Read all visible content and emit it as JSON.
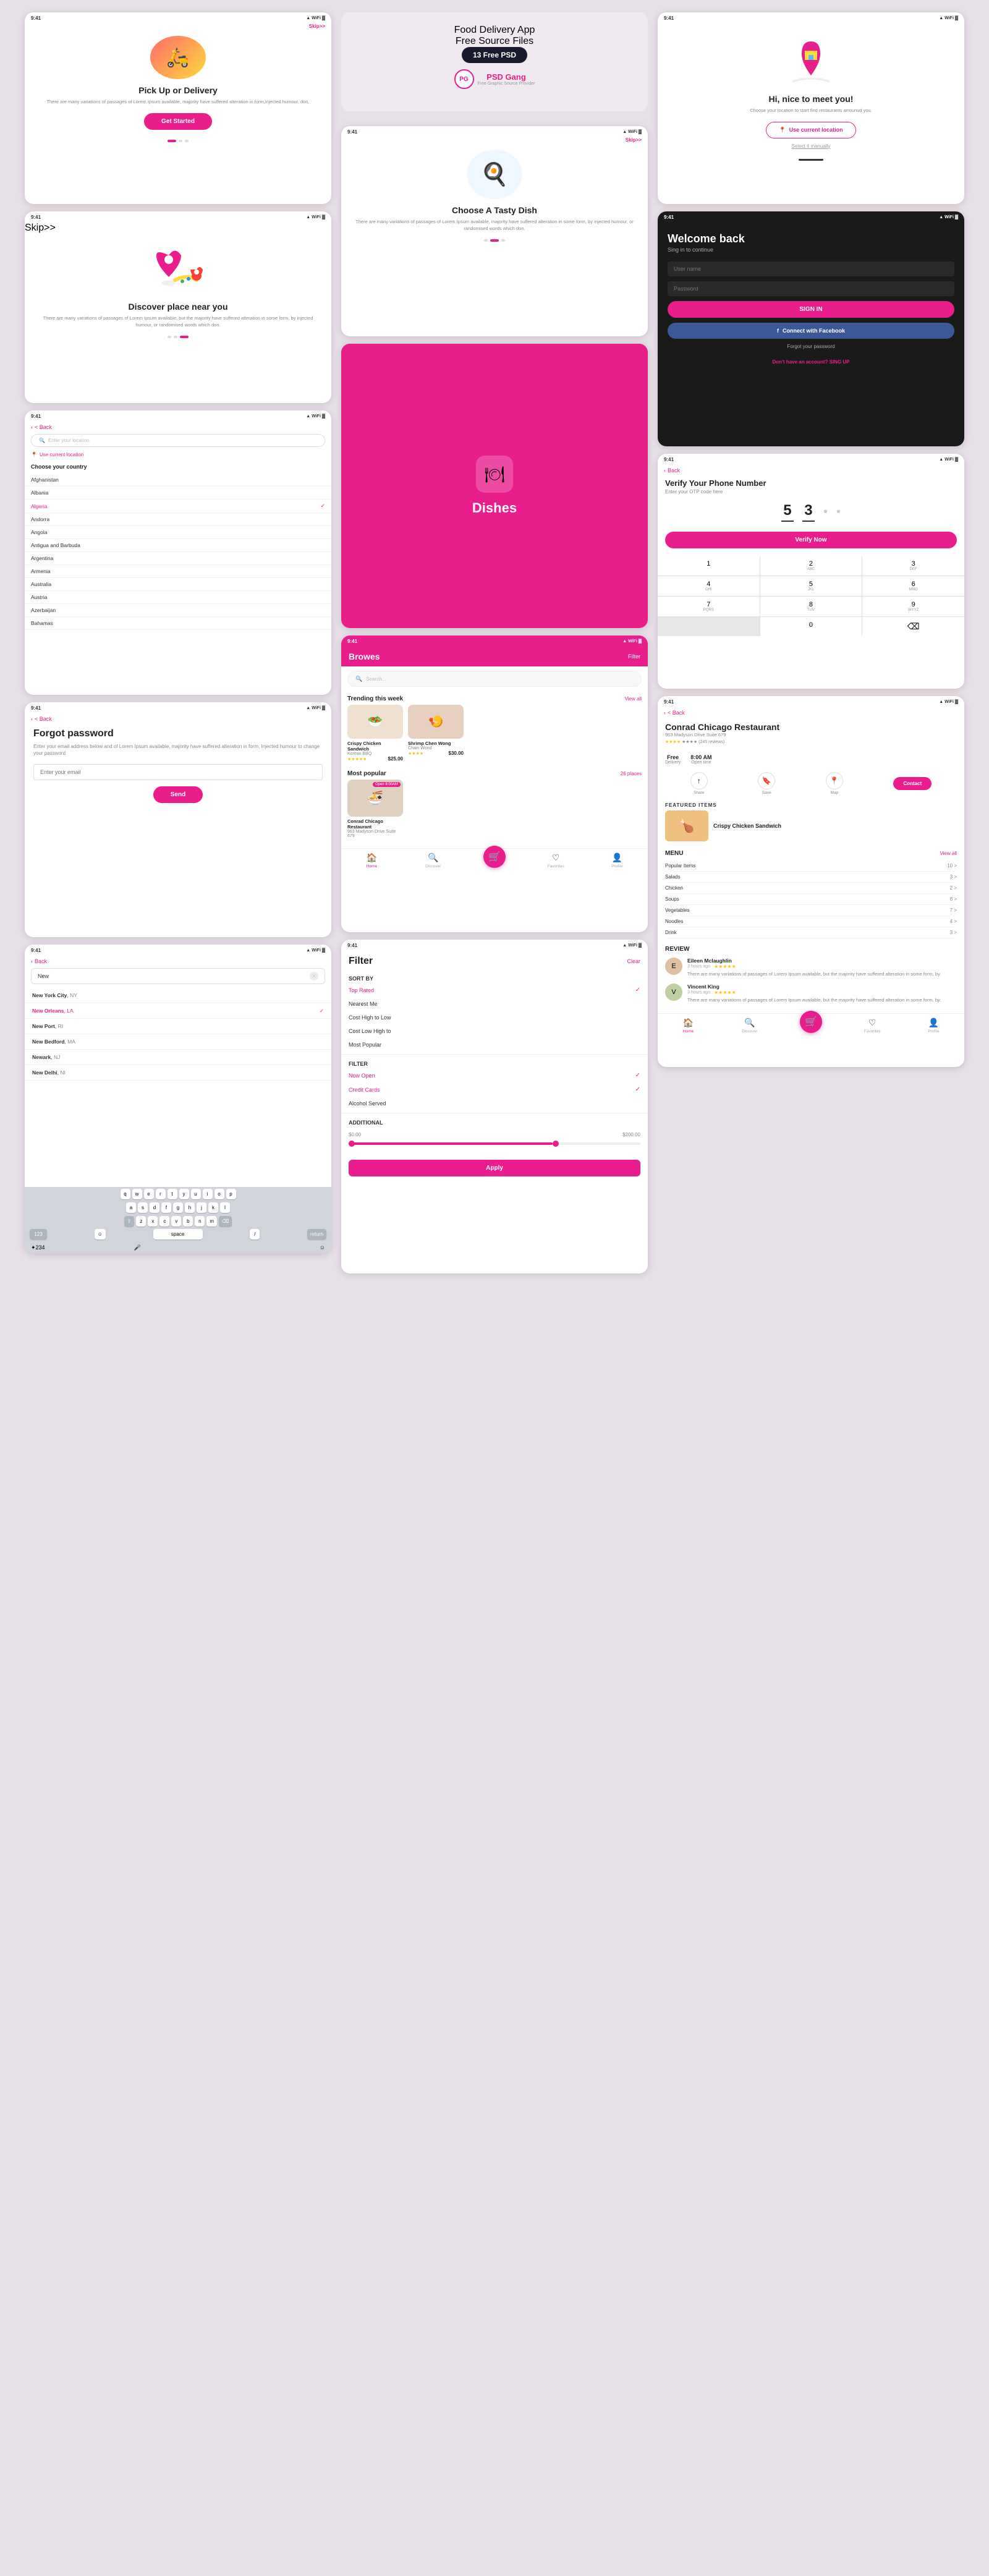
{
  "app": {
    "name": "Food Delivery App",
    "subtitle": "Free Source Files",
    "badge": "13 Free PSD",
    "brand": "PSD Gang",
    "brand_sub": "Free Graphic Source Provider"
  },
  "status": {
    "time": "9:41",
    "signal": "▲",
    "wifi": "⬤",
    "battery": "▓"
  },
  "screens": {
    "pickup": {
      "skip": "Skip>>",
      "title": "Pick Up or Delivery",
      "body": "There are many variations of passages of Lorem Ipsum available, majority have suffered alteration in form,injected humour, don.",
      "btn": "Get Started"
    },
    "tasty_dish": {
      "skip": "Skip>>",
      "title": "Choose A Tasty Dish",
      "body": "There are many variations of passages of Lorem Ipsum available, majority have suffered alteration in some form, by injected humour, or randomised words which don."
    },
    "meet": {
      "title": "Hi, nice to meet  you!",
      "body": "Choose your location to start find restaurants arrounud you.",
      "location_btn": "Use current location",
      "manual": "Select it manually"
    },
    "discover": {
      "skip": "Skip>>",
      "title": "Discover place near you",
      "body": "There are many variations of passages of Lorem Ipsum available, but the majority have suffered alteration in some form, by injected humour, or randomised words which don."
    },
    "dishes_splash": {
      "logo_text": "Dishes"
    },
    "signin": {
      "title": "Welcome back",
      "subtitle": "Sing in to continue",
      "username_placeholder": "User name",
      "password_placeholder": "Password",
      "signin_btn": "SIGN IN",
      "fb_btn": "Connect with Facebook",
      "forgot": "Forgot your password",
      "no_account": "Don't have an account?",
      "signup": "SING UP"
    },
    "location": {
      "back": "< Back",
      "search_placeholder": "Enter your location",
      "use_current": "Use current location",
      "choose_country": "Choose your country",
      "countries": [
        "Afghanistan",
        "Albania",
        "Algeria",
        "Andorra",
        "Angola",
        "Antigua and Barbuda",
        "Argentina",
        "Armenia",
        "Australia",
        "Austria",
        "Azerbaijan",
        "Bahamas"
      ],
      "selected_country": "Algeria"
    },
    "verify": {
      "back": "< Back",
      "title": "Verify Your Phone Number",
      "subtitle": "Enter your OTP code here",
      "digits": [
        "5",
        "3",
        "•",
        "•"
      ],
      "verify_btn": "Verify Now",
      "numpad": [
        [
          "1",
          "",
          ""
        ],
        [
          "2",
          "ABC",
          ""
        ],
        [
          "3",
          "DEF",
          ""
        ],
        [
          "4",
          "GHI",
          ""
        ],
        [
          "5",
          "JKL",
          ""
        ],
        [
          "6",
          "MNO",
          ""
        ],
        [
          "7",
          "PQRS",
          ""
        ],
        [
          "8",
          "TUV",
          ""
        ],
        [
          "9",
          "WXYZ",
          ""
        ],
        [
          "",
          "",
          ""
        ],
        [
          "0",
          "",
          ""
        ],
        [
          "⌫",
          "",
          ""
        ]
      ]
    },
    "forgot": {
      "back": "< Back",
      "title": "Forgot password",
      "body": "Enter your email address below and of Lorem Ipsum available, majority have suffered alteration in form, Injected humour to change your password",
      "email_placeholder": "Enter your email",
      "btn": "Send"
    },
    "browse": {
      "title": "Browes",
      "filter": "Filter",
      "search_placeholder": "Search...",
      "trending_title": "Trending this week",
      "view_all": "View all",
      "trending_items": [
        {
          "name": "Crispy Chicken Sandwich",
          "restaurant": "Korean BBQ",
          "price": "$25.00",
          "stars": "★★★★★",
          "emoji": "🥗"
        },
        {
          "name": "Shrimp Chen Wong",
          "restaurant": "Chain Wond",
          "price": "$30.00",
          "stars": "★★★★",
          "emoji": "🍤"
        }
      ],
      "popular_title": "Most popular",
      "popular_count": "26 places",
      "popular_items": [
        {
          "name": "Conrad Chicago Restaurant",
          "address": "963 Madyson Drive Suite 679",
          "open": "Open 8:00AM",
          "emoji": "🍜"
        }
      ]
    },
    "new_search": {
      "back": "< Back",
      "input_value": "New",
      "results": [
        {
          "city": "New York City",
          "state": "NY",
          "selected": false
        },
        {
          "city": "New Orleans",
          "state": "LA",
          "selected": true
        },
        {
          "city": "New Port",
          "state": "RI",
          "selected": false
        },
        {
          "city": "New Bedford",
          "state": "MA",
          "selected": false
        },
        {
          "city": "Newark",
          "state": "NJ",
          "selected": false
        },
        {
          "city": "New Delhi",
          "state": "NI",
          "selected": false
        }
      ],
      "keyboard_rows": [
        [
          "q",
          "w",
          "e",
          "r",
          "t",
          "y",
          "u",
          "i",
          "o",
          "p"
        ],
        [
          "a",
          "s",
          "d",
          "f",
          "g",
          "h",
          "j",
          "k",
          "l"
        ],
        [
          "⇧",
          "z",
          "x",
          "c",
          "v",
          "b",
          "n",
          "m",
          "⌫"
        ]
      ]
    },
    "filter": {
      "title": "Filter",
      "clear": "Clear",
      "sort_label": "SORT BY",
      "sort_options": [
        {
          "label": "Top Rated",
          "active": false
        },
        {
          "label": "Nearest Me",
          "active": false
        },
        {
          "label": "Cost High to Low",
          "active": false
        },
        {
          "label": "Cost  Low High to",
          "active": false
        },
        {
          "label": "Most Popular",
          "active": false
        }
      ],
      "filter_label": "FILTER",
      "filter_options": [
        {
          "label": "Now Open",
          "active": true
        },
        {
          "label": "Credit Cards",
          "active": true
        },
        {
          "label": "Alcohol Served",
          "active": false
        }
      ],
      "additional_label": "ADDITIONAL",
      "price_min": "$0.00",
      "price_max": "$200.00",
      "apply_btn": "Apply"
    },
    "restaurant": {
      "back": "< Back",
      "name": "Conrad Chicago Restaurant",
      "address": "963 Madyson Drive Suite 679",
      "rating": "★★★★ (245 reviews)",
      "delivery_label": "Delivery",
      "delivery_value": "Free",
      "opentime_label": "Open time",
      "opentime_value": "8:00 AM",
      "featured_label": "FEATURED ITEMS",
      "featured_item": "Crispy Chicken Sandwich",
      "menu_label": "MENU",
      "view_all": "View all",
      "menu_items": [
        {
          "category": "Popular Items",
          "count": 10
        },
        {
          "category": "Salads",
          "count": 3
        },
        {
          "category": "Chicken",
          "count": 2
        },
        {
          "category": "Soups",
          "count": 6
        },
        {
          "category": "Vegetables",
          "count": 7
        },
        {
          "category": "Noodles",
          "count": 4
        },
        {
          "category": "Drink",
          "count": 3
        }
      ],
      "review_label": "REVIEW",
      "reviews": [
        {
          "name": "Eileen Mclaughlin",
          "time": "3 hours ago",
          "stars": "★★★★★",
          "text": "There are many variations of passages of Lorem Ipsum available, but the majority have suffered alteration in some form, by."
        },
        {
          "name": "Vincent King",
          "time": "3 hours ago",
          "stars": "★★★★★",
          "text": "There are many variations of passages of Lorem Ipsum available, but the majority have suffered alteration in some form, by."
        }
      ],
      "contact_btn": "Contact"
    },
    "bottom_nav": {
      "items": [
        {
          "label": "Home",
          "icon": "🏠",
          "active": true
        },
        {
          "label": "Discover",
          "icon": "🔍",
          "active": false
        },
        {
          "label": "",
          "icon": "🛒",
          "active": false,
          "cart": true
        },
        {
          "label": "Favorites",
          "icon": "♡",
          "active": false
        },
        {
          "label": "Profile",
          "icon": "👤",
          "active": false
        }
      ]
    }
  }
}
